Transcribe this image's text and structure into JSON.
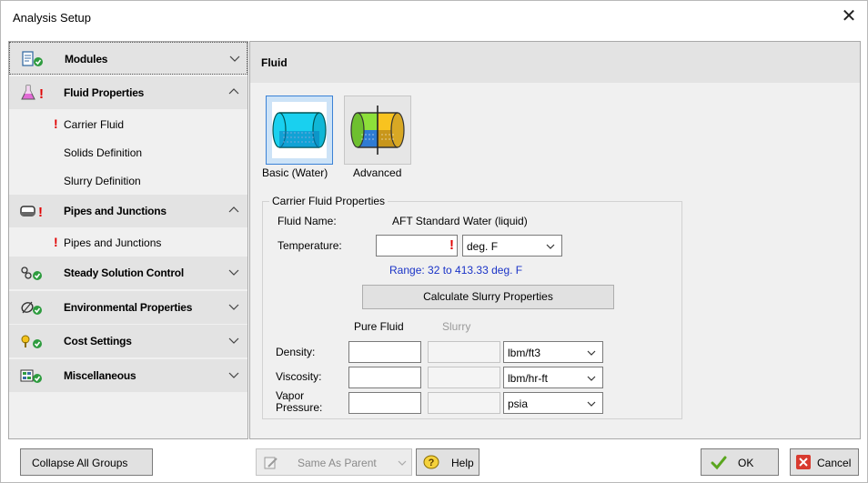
{
  "window": {
    "title": "Analysis Setup",
    "close_glyph": "✕"
  },
  "sidebar": {
    "groups": [
      {
        "label": "Modules",
        "icon": "modules-icon",
        "expanded": false
      },
      {
        "label": "Fluid Properties",
        "icon": "flask-icon",
        "expanded": true,
        "warning": true,
        "items": [
          {
            "label": "Carrier Fluid",
            "warning": true
          },
          {
            "label": "Solids Definition",
            "warning": false
          },
          {
            "label": "Slurry Definition",
            "warning": false
          }
        ]
      },
      {
        "label": "Pipes and Junctions",
        "icon": "pipe-icon",
        "expanded": true,
        "warning": true,
        "items": [
          {
            "label": "Pipes and Junctions",
            "warning": true
          }
        ]
      },
      {
        "label": "Steady Solution Control",
        "icon": "solution-control-icon",
        "expanded": false
      },
      {
        "label": "Environmental Properties",
        "icon": "environment-icon",
        "expanded": false
      },
      {
        "label": "Cost Settings",
        "icon": "cost-icon",
        "expanded": false
      },
      {
        "label": "Miscellaneous",
        "icon": "misc-icon",
        "expanded": false
      }
    ],
    "warning_glyph": "!"
  },
  "content": {
    "title": "Fluid",
    "fluid_options": [
      {
        "label": "Basic (Water)",
        "selected": true
      },
      {
        "label": "Advanced",
        "selected": false
      }
    ],
    "carrier": {
      "legend": "Carrier Fluid Properties",
      "fluid_name_label": "Fluid Name:",
      "fluid_name_value": "AFT Standard Water (liquid)",
      "temperature_label": "Temperature:",
      "temperature_value": "",
      "temperature_unit": "deg. F",
      "range_text": "Range: 32 to 413.33 deg. F",
      "calc_button": "Calculate Slurry Properties",
      "col_pure": "Pure Fluid",
      "col_slurry": "Slurry",
      "rows": [
        {
          "label": "Density:",
          "unit": "lbm/ft3"
        },
        {
          "label": "Viscosity:",
          "unit": "lbm/hr-ft"
        },
        {
          "label": "Vapor\nPressure:",
          "unit": "psia"
        }
      ]
    }
  },
  "footer": {
    "collapse_all": "Collapse All Groups",
    "same_as_parent": "Same As Parent",
    "help": "Help",
    "ok": "OK",
    "cancel": "Cancel"
  },
  "colors": {
    "warning": "#e00000",
    "range_text": "#1a33c7",
    "ok_check": "#5aa61e",
    "cancel_red": "#d83a2f"
  }
}
